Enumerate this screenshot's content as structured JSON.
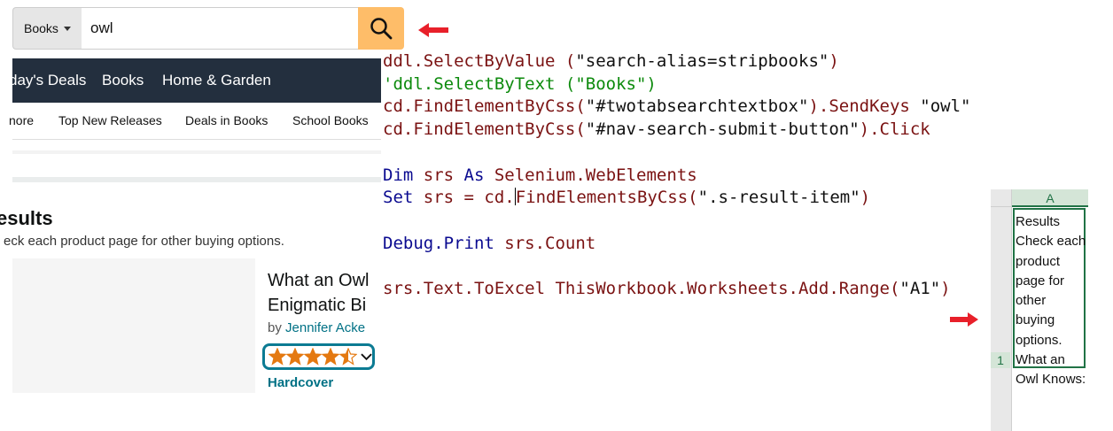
{
  "amazon": {
    "search": {
      "department": "Books",
      "query": "owl"
    },
    "nav_dark": [
      "day's Deals",
      "Books",
      "Home & Garden"
    ],
    "nav_light": [
      "nore",
      "Top New Releases",
      "Deals in Books",
      "School Books"
    ],
    "results": {
      "title": "esults",
      "subtitle": "eck each product page for other buying options.",
      "product": {
        "title": "What an Owl\nEnigmatic Bi",
        "by_prefix": "by",
        "author": "Jennifer Acke",
        "rating_stars": 4.5,
        "format": "Hardcover"
      }
    }
  },
  "code": {
    "lines": [
      {
        "parts": [
          {
            "t": "ddl.SelectByValue (",
            "c": "obj"
          },
          {
            "t": "\"search-alias=stripbooks\"",
            "c": "str"
          },
          {
            "t": ")",
            "c": "obj"
          }
        ]
      },
      {
        "parts": [
          {
            "t": "'ddl.SelectByText (\"Books\")",
            "c": "cm"
          }
        ]
      },
      {
        "parts": [
          {
            "t": "cd.FindElementByCss(",
            "c": "obj"
          },
          {
            "t": "\"#twotabsearchtextbox\"",
            "c": "str"
          },
          {
            "t": ").SendKeys ",
            "c": "obj"
          },
          {
            "t": "\"owl\"",
            "c": "str"
          }
        ]
      },
      {
        "parts": [
          {
            "t": "cd.FindElementByCss(",
            "c": "obj"
          },
          {
            "t": "\"#nav-search-submit-button\"",
            "c": "str"
          },
          {
            "t": ").Click",
            "c": "obj"
          }
        ]
      },
      {
        "parts": []
      },
      {
        "parts": [
          {
            "t": "Dim",
            "c": "kw"
          },
          {
            "t": " srs ",
            "c": "obj"
          },
          {
            "t": "As",
            "c": "kw"
          },
          {
            "t": " Selenium.WebElements",
            "c": "obj"
          }
        ]
      },
      {
        "parts": [
          {
            "t": "Set",
            "c": "kw"
          },
          {
            "t": " srs = cd.",
            "c": "obj"
          },
          {
            "t": "|",
            "c": "cursor"
          },
          {
            "t": "FindElementsByCss(",
            "c": "obj"
          },
          {
            "t": "\".s-result-item\"",
            "c": "str"
          },
          {
            "t": ")",
            "c": "obj"
          }
        ]
      },
      {
        "parts": []
      },
      {
        "parts": [
          {
            "t": "Debug.",
            "c": "kw"
          },
          {
            "t": "Print",
            "c": "kw"
          },
          {
            "t": " srs.Count",
            "c": "obj"
          }
        ]
      },
      {
        "parts": []
      },
      {
        "parts": [
          {
            "t": "srs.Text.ToExcel ThisWorkbook.Worksheets.Add.Range(",
            "c": "obj"
          },
          {
            "t": "\"A1\"",
            "c": "str"
          },
          {
            "t": ")",
            "c": "obj"
          }
        ]
      }
    ]
  },
  "excel": {
    "column": "A",
    "row": "1",
    "cell_text": "Results Check each product page for other buying options. What an Owl Knows:"
  },
  "colors": {
    "amazon_nav": "#232f3e",
    "search_button": "#febd69",
    "link": "#007185",
    "star": "#e47911",
    "excel_green": "#217346",
    "arrow_red": "#e8202a"
  }
}
